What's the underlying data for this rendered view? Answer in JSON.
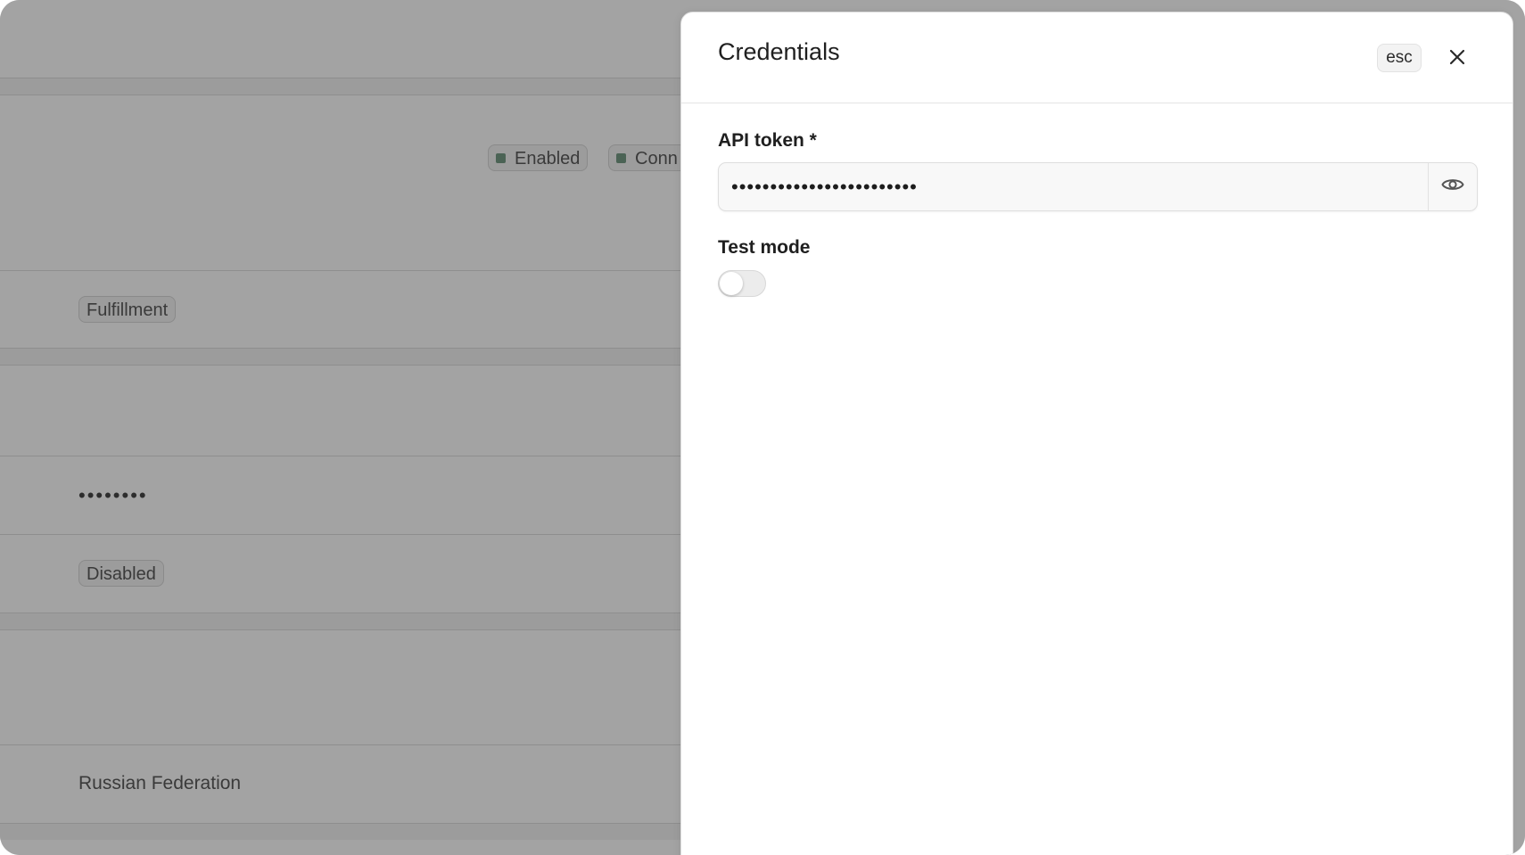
{
  "background": {
    "tags": {
      "enabled": "Enabled",
      "connected_partial": "Conn",
      "fulfillment": "Fulfillment",
      "disabled": "Disabled"
    },
    "masked_value": "••••••••",
    "country": "Russian Federation"
  },
  "drawer": {
    "title": "Credentials",
    "esc_hint": "esc",
    "close_icon": "close-icon",
    "api_token": {
      "label": "API token *",
      "value": "••••••••••••••••••••••••",
      "reveal_icon": "eye-icon"
    },
    "test_mode": {
      "label": "Test mode",
      "enabled": false
    }
  }
}
